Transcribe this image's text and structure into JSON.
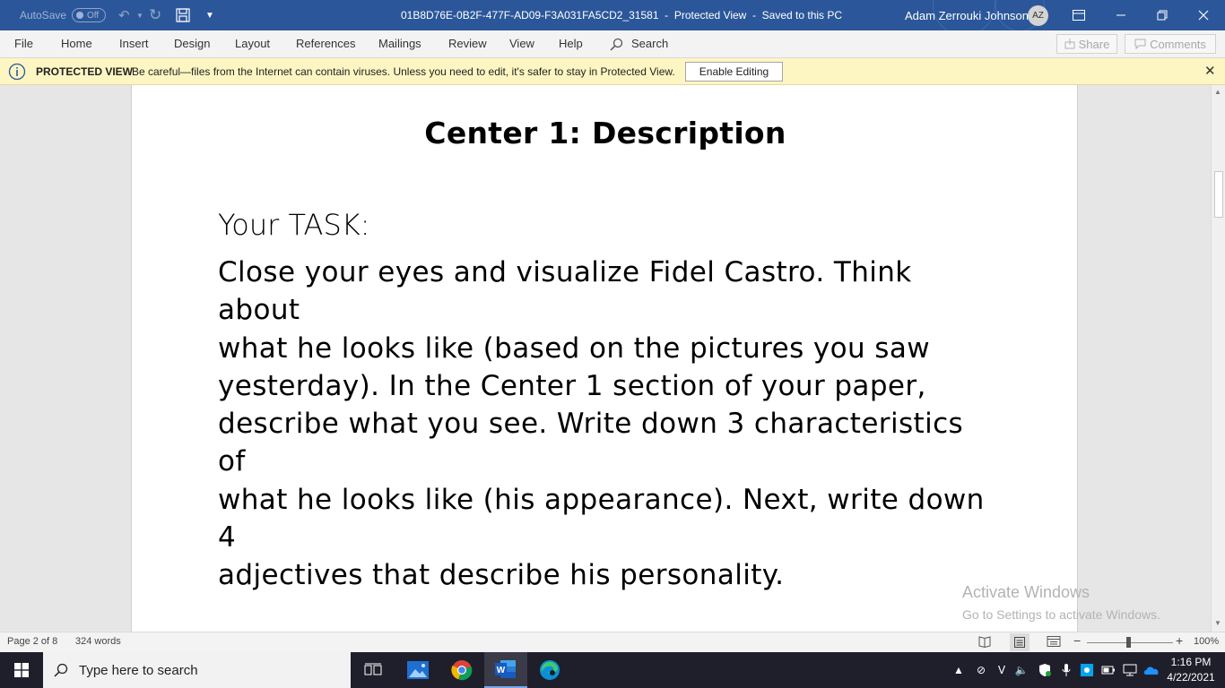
{
  "titlebar": {
    "autosave_label": "AutoSave",
    "autosave_state": "Off",
    "document_title": "01B8D76E-0B2F-477F-AD09-F3A031FA5CD2_31581  -  Protected View  -  Saved to this PC",
    "user_name": "Adam Zerrouki Johnson",
    "user_initials": "AZ"
  },
  "menu": {
    "tabs": [
      "File",
      "Home",
      "Insert",
      "Design",
      "Layout",
      "References",
      "Mailings",
      "Review",
      "View",
      "Help"
    ],
    "search_label": "Search",
    "share_label": "Share",
    "comments_label": "Comments"
  },
  "protected_view": {
    "title": "PROTECTED VIEW",
    "message": "Be careful—files from the Internet can contain viruses. Unless you need to edit, it's safer to stay in Protected View.",
    "enable_label": "Enable Editing"
  },
  "document": {
    "heading": "Center 1: Description",
    "task_label": "Your TASK:",
    "task_lines": [
      "Close your eyes and visualize Fidel Castro. Think about",
      "what he looks like (based on the pictures you saw",
      "yesterday). In the Center 1 section of your paper,",
      "describe what you see. Write down 3 characteristics of",
      "what he looks like (his appearance). Next, write down 4",
      "adjectives that describe his personality."
    ]
  },
  "watermark": {
    "title": "Activate Windows",
    "subtitle": "Go to Settings to activate Windows."
  },
  "statusbar": {
    "page_info": "Page 2 of 8",
    "word_count": "324 words",
    "zoom": "100%"
  },
  "taskbar": {
    "search_placeholder": "Type here to search",
    "time": "1:16 PM",
    "date": "4/22/2021"
  },
  "colors": {
    "word_blue": "#2b579a",
    "protected_bar": "#fdf6c3",
    "taskbar": "#1f1f2b"
  }
}
